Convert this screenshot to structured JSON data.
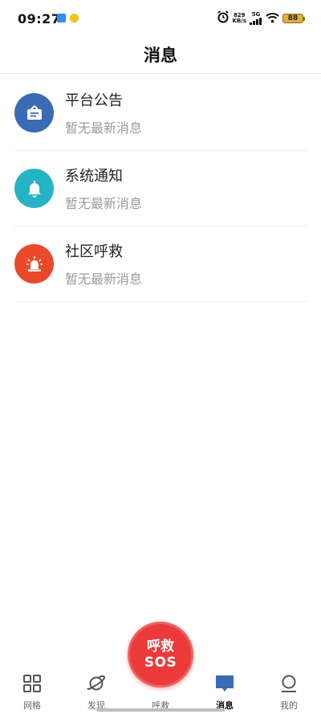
{
  "status_bar": {
    "time": "09:27",
    "net_speed_value": "829",
    "net_speed_unit": "KB/s",
    "network_type": "5G",
    "battery": "88"
  },
  "header": {
    "title": "消息"
  },
  "messages": [
    {
      "title": "平台公告",
      "subtitle": "暂无最新消息",
      "icon": "announcement-icon",
      "color": "#3a6bb5"
    },
    {
      "title": "系统通知",
      "subtitle": "暂无最新消息",
      "icon": "bell-icon",
      "color": "#26b3c6"
    },
    {
      "title": "社区呼救",
      "subtitle": "暂无最新消息",
      "icon": "alarm-light-icon",
      "color": "#ea4a2a"
    }
  ],
  "tab_bar": {
    "tabs": [
      {
        "label": "网格",
        "icon": "grid-icon",
        "active": false
      },
      {
        "label": "发现",
        "icon": "planet-icon",
        "active": false
      },
      {
        "label": "呼救",
        "icon": "sos-icon",
        "active": false
      },
      {
        "label": "消息",
        "icon": "message-icon",
        "active": true
      },
      {
        "label": "我的",
        "icon": "user-icon",
        "active": false
      }
    ],
    "sos": {
      "line1": "呼救",
      "line2": "SOS"
    }
  },
  "colors": {
    "accent": "#3a6bb5",
    "sos_red": "#ea3a3a"
  }
}
